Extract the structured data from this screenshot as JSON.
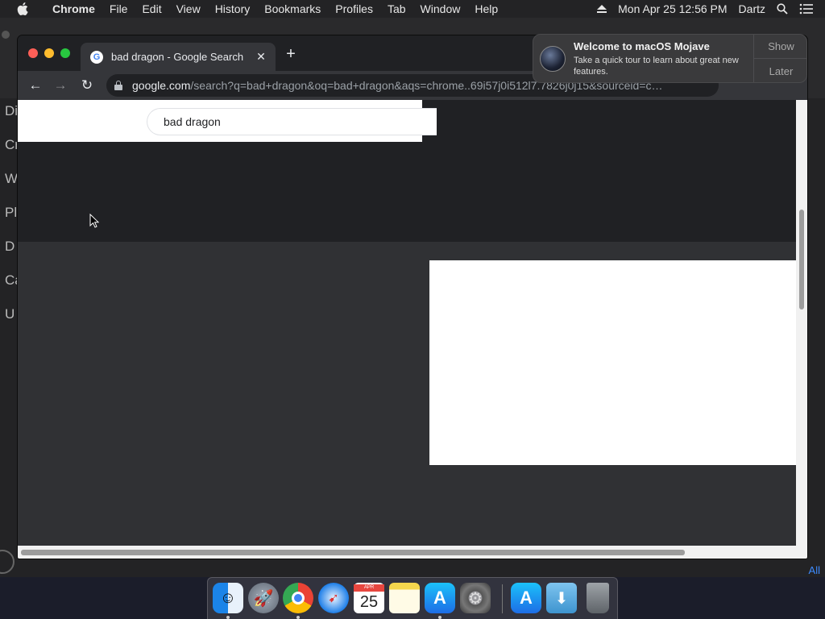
{
  "menubar": {
    "app_name": "Chrome",
    "menus": [
      "File",
      "Edit",
      "View",
      "History",
      "Bookmarks",
      "Profiles",
      "Tab",
      "Window",
      "Help"
    ],
    "datetime": "Mon Apr 25  12:56 PM",
    "user": "Dartz"
  },
  "background_app": {
    "sidebar_fragments": [
      "Di",
      "Cr",
      "W",
      "Pl",
      "D",
      "Ca",
      "U"
    ],
    "right_fragment": "All"
  },
  "browser": {
    "tab_title": "bad dragon - Google Search",
    "url_domain": "google.com",
    "url_path": "/search?q=bad+dragon&oq=bad+dragon&aqs=chrome..69i57j0i512l7.7826j0j15&sourceid=c…",
    "search_query": "bad dragon"
  },
  "notification": {
    "title": "Welcome to macOS Mojave",
    "body": "Take a quick tour to learn about great new features.",
    "show_label": "Show",
    "later_label": "Later"
  },
  "dock": {
    "apps": [
      "finder",
      "launchpad",
      "chrome",
      "safari",
      "calendar",
      "notes",
      "app-store",
      "system-preferences",
      "app-store",
      "downloads",
      "trash"
    ],
    "calendar_month": "APR",
    "calendar_day": "25"
  }
}
